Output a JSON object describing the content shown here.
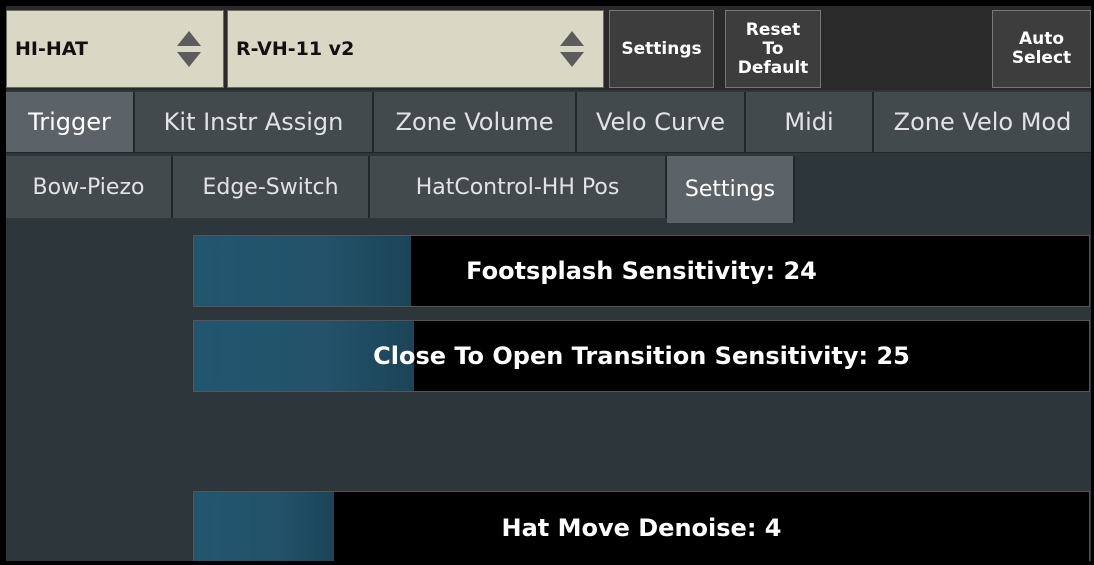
{
  "toolbar": {
    "instrument_select": "HI-HAT",
    "model_select": "R-VH-11 v2",
    "settings_label": "Settings",
    "reset_label_line1": "Reset",
    "reset_label_line2": "To",
    "reset_label_line3": "Default",
    "auto_select_line1": "Auto",
    "auto_select_line2": "Select"
  },
  "tabs": [
    "Trigger",
    "Kit Instr Assign",
    "Zone Volume",
    "Velo Curve",
    "Midi",
    "Zone Velo Mod"
  ],
  "subtabs": [
    "Bow-Piezo",
    "Edge-Switch",
    "HatControl-HH Pos",
    "Settings"
  ],
  "active_tab": "Trigger",
  "active_subtab": "Settings",
  "sliders": [
    {
      "label": "Footsplash Sensitivity: 24",
      "value": 24
    },
    {
      "label": "Close To Open Transition Sensitivity: 25",
      "value": 25
    },
    {
      "label": "Hat Move Denoise: 4",
      "value": 4
    }
  ],
  "colors": {
    "slider_fill": "#21566f",
    "background": "#2d363b",
    "select_bg": "#d9d8c5"
  }
}
